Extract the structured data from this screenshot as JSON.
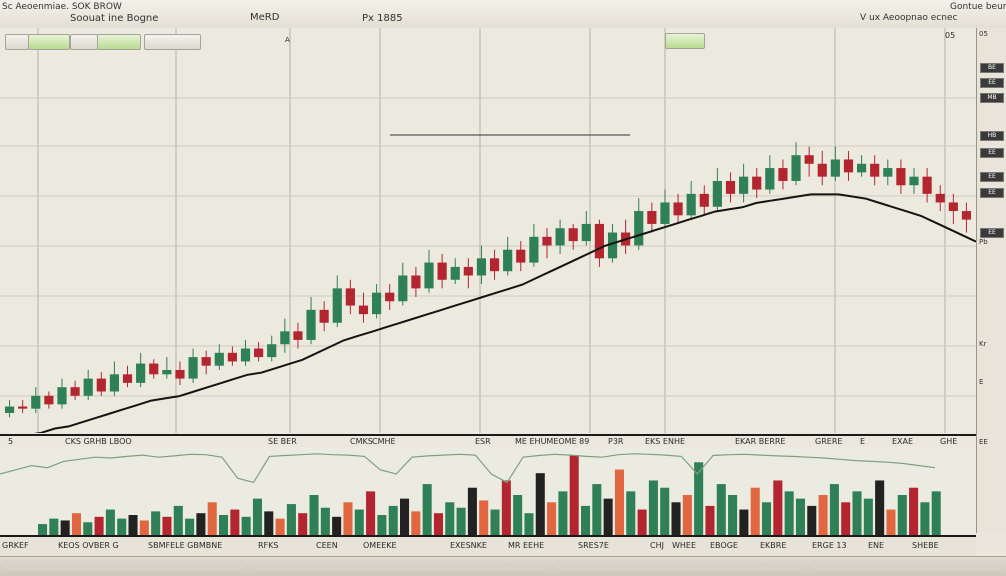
{
  "topbar": {
    "left_title": "Sc Aeoenmiae. SOK BROW",
    "doc_title": "Soouat ine Bogne",
    "center_tab": "MeRD",
    "center_num": "Px 1885",
    "right_info": "V ux Aeoopnao ecnec",
    "right_corner": "Gontue beumes"
  },
  "toolbar": {
    "btn1": "",
    "btn2": "",
    "btn3": "",
    "btn4": "",
    "marker": "A",
    "btn_green_right": "",
    "corner_label": "05"
  },
  "price_axis_labels": [
    "5",
    "CKS GRHB LBOO",
    "SE BER",
    "CMKS",
    "CMHE",
    "ESR",
    "ME EHUMEOME 89",
    "P3R",
    "EKS ENHE",
    "EKAR BERRE",
    "GRERE",
    "E",
    "EXAE",
    "GHE"
  ],
  "bottom_axis_labels": [
    "GRKEF",
    "KEOS OVBER G",
    "SBMFELE GBMBNE",
    "RFKS",
    "CEEN",
    "OMEEKE",
    "EXESNKE",
    "MR EEHE",
    "SRES7E",
    "CHJ",
    "WHEE",
    "EBOGE",
    "EKBRE",
    "ERGE 13",
    "ENE",
    "SHEBE"
  ],
  "right_panel": {
    "labels": [
      "05",
      "Pb",
      "Kr",
      "E",
      "EE"
    ],
    "markers": [
      "BE",
      "EE",
      "MB",
      "HB",
      "EE",
      "EE",
      "EE",
      "EE"
    ]
  },
  "colors": {
    "bullish": "#2f7f57",
    "bearish": "#b3262f",
    "ma_line": "#141414",
    "volume_orange": "#e0673f",
    "volume_dark": "#222222",
    "oscillator": "#7ea07f"
  },
  "chart_data": {
    "type": "candlestick",
    "candles": [
      {
        "o": 2,
        "c": 5,
        "h": 8,
        "l": 0
      },
      {
        "o": 5,
        "c": 4,
        "h": 8,
        "l": 2
      },
      {
        "o": 4,
        "c": 10,
        "h": 14,
        "l": 2
      },
      {
        "o": 10,
        "c": 6,
        "h": 12,
        "l": 4
      },
      {
        "o": 6,
        "c": 14,
        "h": 18,
        "l": 4
      },
      {
        "o": 14,
        "c": 10,
        "h": 17,
        "l": 8
      },
      {
        "o": 10,
        "c": 18,
        "h": 22,
        "l": 8
      },
      {
        "o": 18,
        "c": 12,
        "h": 21,
        "l": 10
      },
      {
        "o": 12,
        "c": 20,
        "h": 26,
        "l": 10
      },
      {
        "o": 20,
        "c": 16,
        "h": 24,
        "l": 14
      },
      {
        "o": 16,
        "c": 25,
        "h": 30,
        "l": 14
      },
      {
        "o": 25,
        "c": 20,
        "h": 27,
        "l": 18
      },
      {
        "o": 20,
        "c": 22,
        "h": 28,
        "l": 18
      },
      {
        "o": 22,
        "c": 18,
        "h": 26,
        "l": 15
      },
      {
        "o": 18,
        "c": 28,
        "h": 32,
        "l": 16
      },
      {
        "o": 28,
        "c": 24,
        "h": 31,
        "l": 20
      },
      {
        "o": 24,
        "c": 30,
        "h": 34,
        "l": 22
      },
      {
        "o": 30,
        "c": 26,
        "h": 33,
        "l": 24
      },
      {
        "o": 26,
        "c": 32,
        "h": 36,
        "l": 24
      },
      {
        "o": 32,
        "c": 28,
        "h": 35,
        "l": 26
      },
      {
        "o": 28,
        "c": 34,
        "h": 38,
        "l": 26
      },
      {
        "o": 34,
        "c": 40,
        "h": 46,
        "l": 30
      },
      {
        "o": 40,
        "c": 36,
        "h": 44,
        "l": 32
      },
      {
        "o": 36,
        "c": 50,
        "h": 56,
        "l": 34
      },
      {
        "o": 50,
        "c": 44,
        "h": 54,
        "l": 40
      },
      {
        "o": 44,
        "c": 60,
        "h": 66,
        "l": 42
      },
      {
        "o": 60,
        "c": 52,
        "h": 64,
        "l": 48
      },
      {
        "o": 52,
        "c": 48,
        "h": 58,
        "l": 44
      },
      {
        "o": 48,
        "c": 58,
        "h": 62,
        "l": 46
      },
      {
        "o": 58,
        "c": 54,
        "h": 62,
        "l": 50
      },
      {
        "o": 54,
        "c": 66,
        "h": 72,
        "l": 52
      },
      {
        "o": 66,
        "c": 60,
        "h": 70,
        "l": 56
      },
      {
        "o": 60,
        "c": 72,
        "h": 78,
        "l": 58
      },
      {
        "o": 72,
        "c": 64,
        "h": 76,
        "l": 60
      },
      {
        "o": 64,
        "c": 70,
        "h": 74,
        "l": 62
      },
      {
        "o": 70,
        "c": 66,
        "h": 74,
        "l": 60
      },
      {
        "o": 66,
        "c": 74,
        "h": 80,
        "l": 62
      },
      {
        "o": 74,
        "c": 68,
        "h": 78,
        "l": 64
      },
      {
        "o": 68,
        "c": 78,
        "h": 84,
        "l": 66
      },
      {
        "o": 78,
        "c": 72,
        "h": 82,
        "l": 68
      },
      {
        "o": 72,
        "c": 84,
        "h": 90,
        "l": 70
      },
      {
        "o": 84,
        "c": 80,
        "h": 88,
        "l": 74
      },
      {
        "o": 80,
        "c": 88,
        "h": 92,
        "l": 76
      },
      {
        "o": 88,
        "c": 82,
        "h": 90,
        "l": 78
      },
      {
        "o": 82,
        "c": 90,
        "h": 96,
        "l": 80
      },
      {
        "o": 90,
        "c": 74,
        "h": 92,
        "l": 70
      },
      {
        "o": 74,
        "c": 86,
        "h": 90,
        "l": 72
      },
      {
        "o": 86,
        "c": 80,
        "h": 92,
        "l": 76
      },
      {
        "o": 80,
        "c": 96,
        "h": 102,
        "l": 78
      },
      {
        "o": 96,
        "c": 90,
        "h": 100,
        "l": 86
      },
      {
        "o": 90,
        "c": 100,
        "h": 106,
        "l": 88
      },
      {
        "o": 100,
        "c": 94,
        "h": 104,
        "l": 90
      },
      {
        "o": 94,
        "c": 104,
        "h": 110,
        "l": 92
      },
      {
        "o": 104,
        "c": 98,
        "h": 108,
        "l": 94
      },
      {
        "o": 98,
        "c": 110,
        "h": 116,
        "l": 96
      },
      {
        "o": 110,
        "c": 104,
        "h": 114,
        "l": 100
      },
      {
        "o": 104,
        "c": 112,
        "h": 118,
        "l": 100
      },
      {
        "o": 112,
        "c": 106,
        "h": 116,
        "l": 102
      },
      {
        "o": 106,
        "c": 116,
        "h": 122,
        "l": 104
      },
      {
        "o": 116,
        "c": 110,
        "h": 120,
        "l": 106
      },
      {
        "o": 110,
        "c": 122,
        "h": 128,
        "l": 108
      },
      {
        "o": 122,
        "c": 118,
        "h": 126,
        "l": 112
      },
      {
        "o": 118,
        "c": 112,
        "h": 124,
        "l": 108
      },
      {
        "o": 112,
        "c": 120,
        "h": 126,
        "l": 110
      },
      {
        "o": 120,
        "c": 114,
        "h": 124,
        "l": 110
      },
      {
        "o": 114,
        "c": 118,
        "h": 122,
        "l": 112
      },
      {
        "o": 118,
        "c": 112,
        "h": 122,
        "l": 108
      },
      {
        "o": 112,
        "c": 116,
        "h": 120,
        "l": 108
      },
      {
        "o": 116,
        "c": 108,
        "h": 120,
        "l": 104
      },
      {
        "o": 108,
        "c": 112,
        "h": 116,
        "l": 104
      },
      {
        "o": 112,
        "c": 104,
        "h": 116,
        "l": 100
      },
      {
        "o": 104,
        "c": 100,
        "h": 108,
        "l": 96
      },
      {
        "o": 100,
        "c": 96,
        "h": 104,
        "l": 90
      },
      {
        "o": 96,
        "c": 92,
        "h": 100,
        "l": 86
      }
    ],
    "moving_average": [
      0,
      1,
      2,
      3,
      5,
      6,
      8,
      10,
      12,
      14,
      16,
      18,
      19,
      20,
      22,
      24,
      26,
      28,
      30,
      31,
      33,
      35,
      37,
      40,
      43,
      46,
      48,
      50,
      52,
      54,
      56,
      58,
      60,
      62,
      64,
      66,
      68,
      70,
      72,
      75,
      78,
      81,
      84,
      87,
      90,
      92,
      94,
      96,
      98,
      100,
      102,
      104,
      106,
      107,
      108,
      110,
      111,
      112,
      113,
      114,
      114,
      114,
      113,
      112,
      110,
      108,
      106,
      104,
      101,
      98,
      95,
      92
    ],
    "volume": [
      6,
      9,
      8,
      12,
      7,
      10,
      14,
      9,
      11,
      8,
      13,
      10,
      16,
      9,
      12,
      18,
      11,
      14,
      10,
      20,
      13,
      9,
      17,
      12,
      22,
      15,
      10,
      18,
      14,
      24,
      11,
      16,
      20,
      13,
      28,
      12,
      18,
      15,
      26,
      19,
      14,
      30,
      22,
      12,
      34,
      18,
      24,
      44,
      16,
      28,
      20,
      36,
      24,
      14,
      30,
      26,
      18,
      22,
      40,
      16,
      28,
      22,
      14,
      26,
      18,
      30,
      24,
      20,
      16,
      22,
      28,
      18,
      24,
      20,
      30,
      14,
      22,
      26,
      18,
      24
    ],
    "oscillator": [
      0.5,
      0.6,
      0.7,
      0.65,
      0.8,
      0.85,
      0.9,
      0.88,
      0.92,
      0.95,
      0.9,
      0.93,
      0.97,
      0.96,
      0.9,
      0.4,
      0.3,
      0.92,
      0.94,
      0.96,
      0.98,
      0.96,
      0.95,
      0.92,
      0.6,
      0.5,
      0.9,
      0.93,
      0.95,
      0.97,
      0.95,
      0.5,
      0.3,
      0.9,
      0.94,
      0.97,
      0.95,
      0.92,
      0.9,
      0.96,
      0.98,
      0.97,
      0.95,
      0.92,
      0.5,
      0.94,
      0.96,
      0.97,
      0.95,
      0.93,
      0.92,
      0.9,
      0.88,
      0.85,
      0.82,
      0.8,
      0.78,
      0.75,
      0.7,
      0.65
    ]
  }
}
